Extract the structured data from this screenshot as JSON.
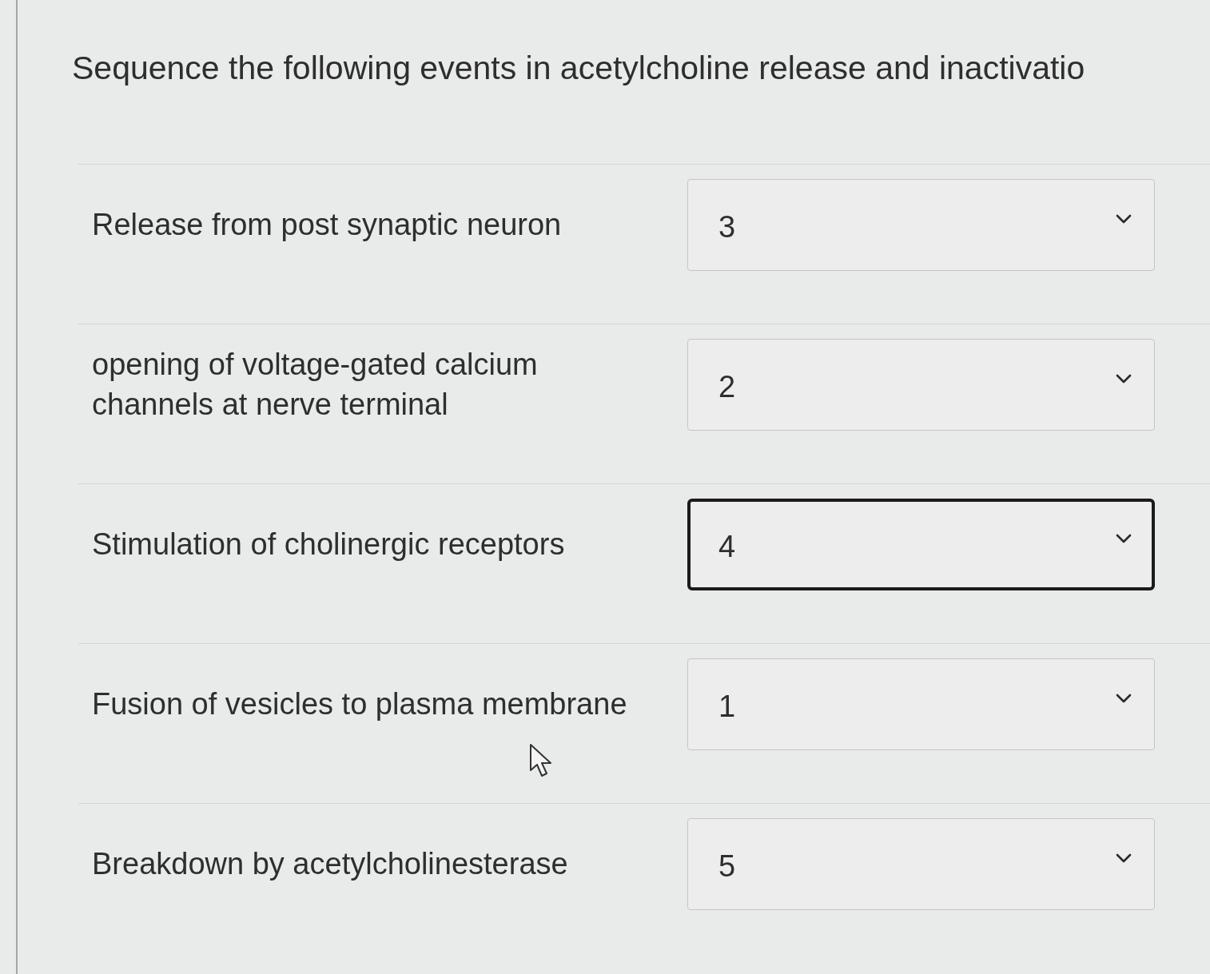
{
  "question": {
    "title": "Sequence the following events in acetylcholine release and inactivatio"
  },
  "items": [
    {
      "label": "Release from post synaptic neuron",
      "value": "3",
      "focused": false
    },
    {
      "label": "opening of voltage-gated calcium channels at nerve terminal",
      "value": "2",
      "focused": false
    },
    {
      "label": "Stimulation of cholinergic receptors",
      "value": "4",
      "focused": true
    },
    {
      "label": "Fusion of vesicles to plasma membrane",
      "value": "1",
      "focused": false
    },
    {
      "label": "Breakdown by acetylcholinesterase",
      "value": "5",
      "focused": false
    }
  ]
}
